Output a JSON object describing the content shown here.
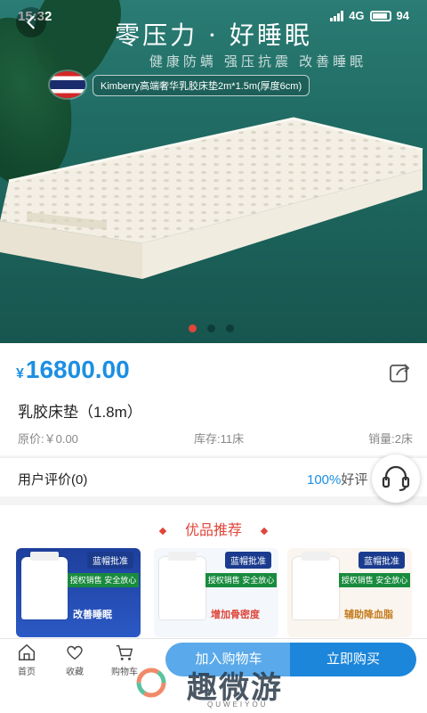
{
  "status": {
    "time": "15:32",
    "battery": "94",
    "network": "4G"
  },
  "banner": {
    "title": "零压力 · 好睡眠",
    "subtitle": "健康防螨  强压抗震  改善睡眠",
    "spec": "Kimberry高端奢华乳胶床垫2m*1.5m(厚度6cm)",
    "slides": 3,
    "active_slide": 1
  },
  "product": {
    "currency": "¥",
    "price": "16800.00",
    "title": "乳胶床垫（1.8m）",
    "original_price": "原价:￥0.00",
    "stock": "库存:11床",
    "sales": "销量:2床"
  },
  "review": {
    "label": "用户评价(0)",
    "rate": "100%",
    "rate_suffix": "好评"
  },
  "recommend": {
    "title": "优品推荐",
    "cards": [
      {
        "tag": "蓝帽批准",
        "band": "授权销售 安全放心",
        "caption": "改善睡眠"
      },
      {
        "tag": "蓝帽批准",
        "band": "授权销售 安全放心",
        "caption": "增加骨密度"
      },
      {
        "tag": "蓝帽批准",
        "band": "授权销售 安全放心",
        "caption": "辅助降血脂"
      }
    ]
  },
  "bottom_bar": {
    "home": "首页",
    "favorite": "收藏",
    "cart": "购物车",
    "add_to_cart": "加入购物车",
    "buy_now": "立即购买"
  },
  "watermark": {
    "text": "趣微游",
    "sub": "QUWEIYOU"
  },
  "colors": {
    "accent": "#1c8fe3",
    "red": "#e0453a",
    "banner": "#1f6a62"
  }
}
